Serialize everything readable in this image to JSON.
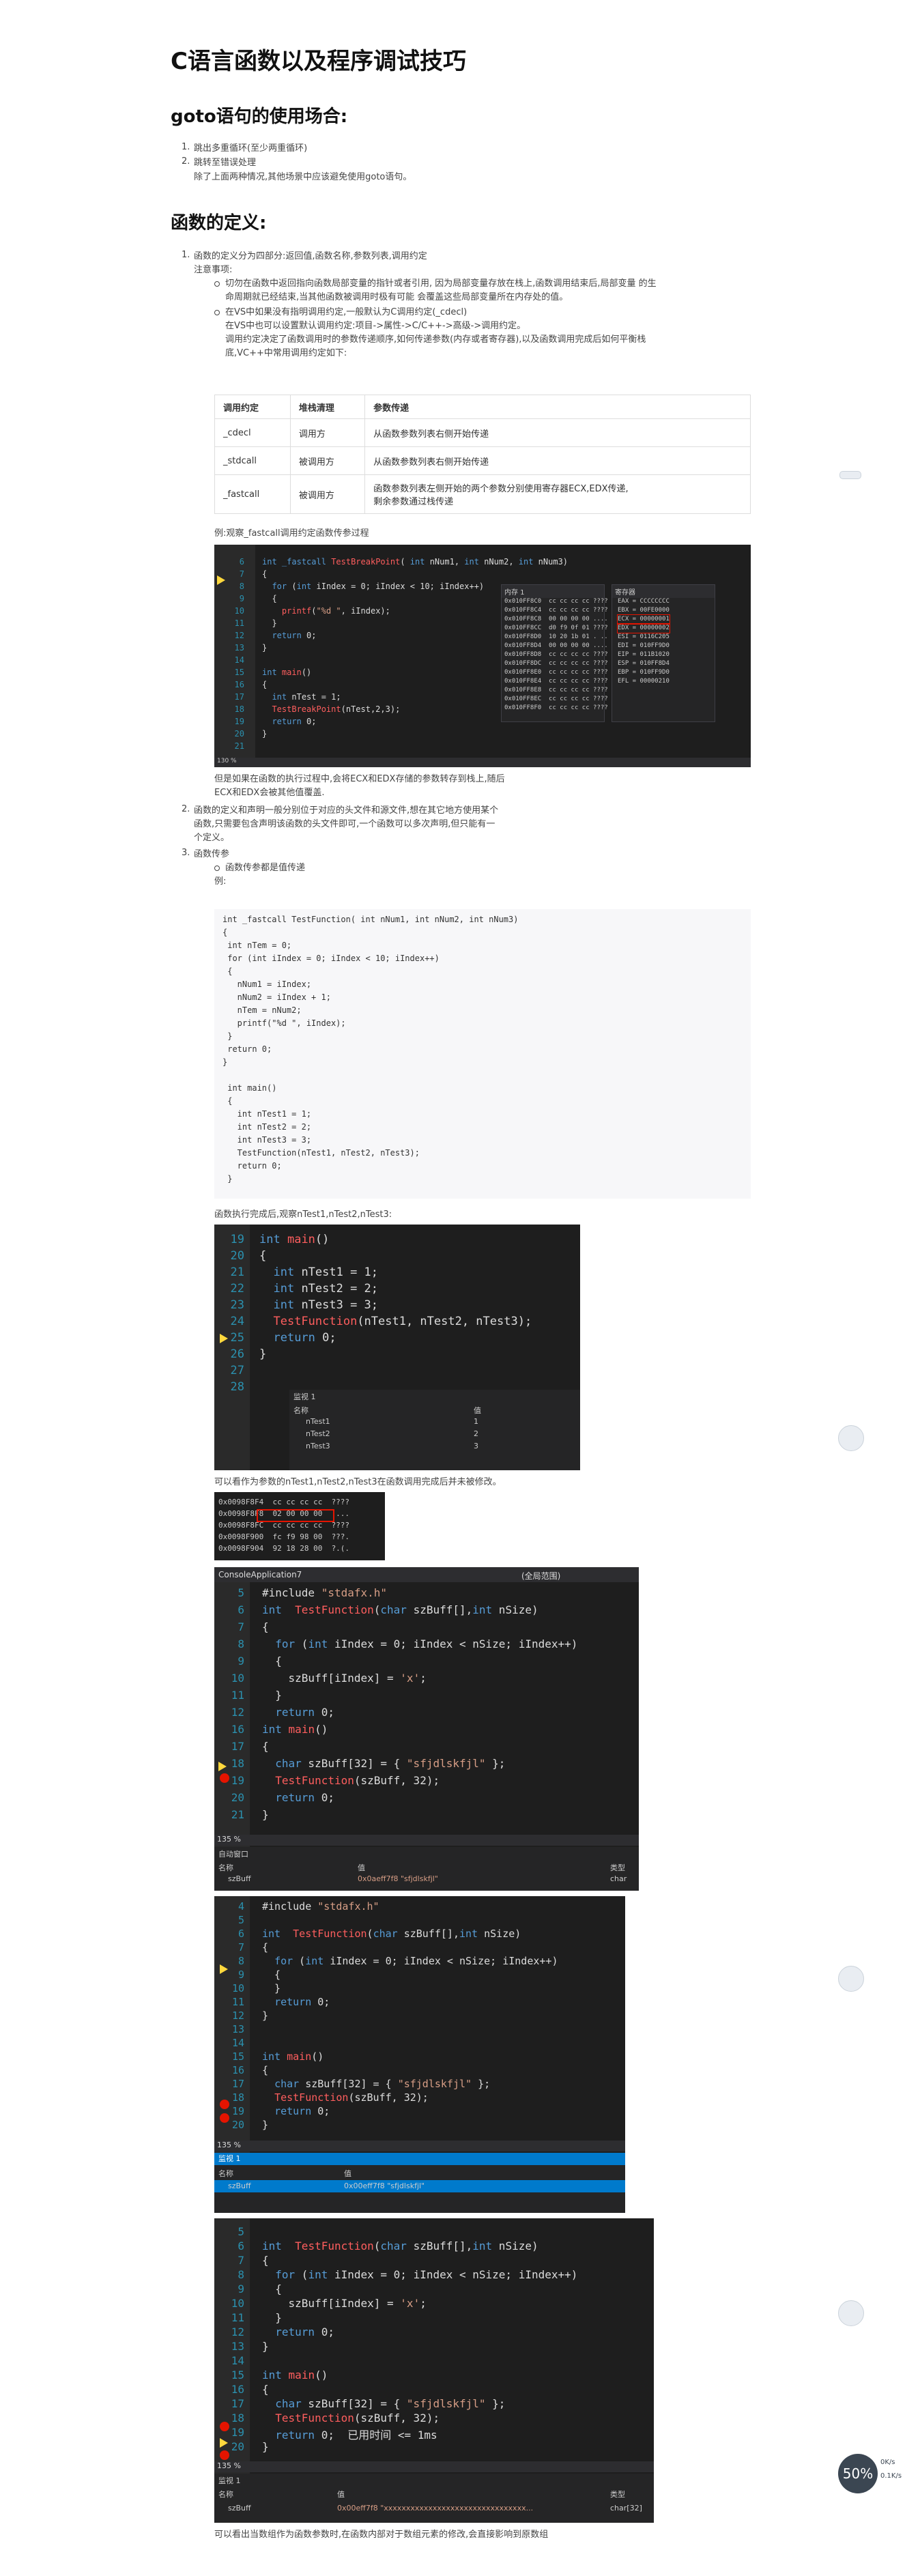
{
  "title": "C语言函数以及程序调试技巧",
  "section_goto": {
    "heading": "goto语句的使用场合:",
    "items": [
      "跳出多重循环(至少两重循环)",
      "跳转至错误处理"
    ],
    "note": "除了上面两种情况,其他场景中应该避免使用goto语句。"
  },
  "section_def": {
    "heading": "函数的定义:",
    "item1": "函数的定义分为四部分:返回值,函数名称,参数列表,调用约定",
    "note_title": "注意事项:",
    "bullet1_l1": "切勿在函数中返回指向函数局部变量的指针或者引用, 因为局部变量存放在栈上,函数调用结束后,局部变量 的生",
    "bullet1_l2": "命周期就已经结束,当其他函数被调用时极有可能 会覆盖这些局部变量所在内存处的值。",
    "bullet2_l1": "在VS中如果没有指明调用约定,一般默认为C调用约定(_cdecl)",
    "bullet2_l2": "在VS中也可以设置默认调用约定:项目->属性->C/C++->高级->调用约定。",
    "bullet2_l3": "调用约定决定了函数调用时的参数传递顺序,如何传递参数(内存或者寄存器),以及函数调用完成后如何平衡栈",
    "bullet2_l4": "底,VC++中常用调用约定如下:",
    "table_headers": [
      "调用约定",
      "堆栈清理",
      "参数传递"
    ],
    "table_rows": [
      [
        "_cdecl",
        "调用方",
        "从函数参数列表右侧开始传递"
      ],
      [
        "_stdcall",
        "被调用方",
        "从函数参数列表右侧开始传递"
      ],
      [
        "_fastcall",
        "被调用方",
        "函数参数列表左侧开始的两个参数分别使用寄存器ECX,EDX传递,",
        "剩余参数通过栈传递"
      ]
    ],
    "example_caption": "例:观察_fastcall调用约定函数传参过程",
    "after_shot1_l1": "但是如果在函数的执行过程中,会将ECX和EDX存储的参数转存到栈上,随后",
    "after_shot1_l2": "ECX和EDX会被其他值覆盖.",
    "item2_l1": "函数的定义和声明一般分别位于对应的头文件和源文件,想在其它地方使用某个",
    "item2_l2": "函数,只需要包含声明该函数的头文件即可,一个函数可以多次声明,但只能有一",
    "item2_l3": "个定义。",
    "item3": "函数传参",
    "bullet3": "函数传参都是值传递",
    "example_label": "例:",
    "after_code_caption": "函数执行完成后,观察nTest1,nTest2,nTest3:",
    "after_shot2": "可以看作为参数的nTest1,nTest2,nTest3在函数调用完成后并未被修改。",
    "bottom_caption": "可以看出当数组作为函数参数时,在函数内部对于数组元素的修改,会直接影响到原数组"
  },
  "code_block": [
    "int _fastcall TestFunction( int nNum1, int nNum2, int nNum3)",
    "{",
    " int nTem = 0;",
    " for (int iIndex = 0; iIndex < 10; iIndex++)",
    " {",
    "   nNum1 = iIndex;",
    "   nNum2 = iIndex + 1;",
    "   nTem = nNum2;",
    "   printf(\"%d \", iIndex);",
    " }",
    " return 0;",
    "}",
    "",
    " int main()",
    " {",
    "   int nTest1 = 1;",
    "   int nTest2 = 2;",
    "   int nTest3 = 3;",
    "   TestFunction(nTest1, nTest2, nTest3);",
    "   return 0;",
    " }"
  ],
  "shot1": {
    "lines": [
      "6",
      "7",
      "8",
      "9",
      "10",
      "11",
      "12",
      "13",
      "14",
      "15",
      "16",
      "17",
      "18",
      "19",
      "20",
      "21"
    ],
    "code": [
      "int _fastcall TestBreakPoint( int nNum1, int nNum2, int nNum3)",
      "{",
      "  for (int iIndex = 0; iIndex < 10; iIndex++)",
      "  {",
      "    printf(\"%d \", iIndex);",
      "  }",
      "  return 0;",
      "}",
      "",
      "int main()",
      "{",
      "  int nTest = 1;",
      "  TestBreakPoint(nTest,2,3);",
      "  return 0;",
      "}",
      ""
    ],
    "mem_title": "内存 1",
    "reg_title": "寄存器",
    "regs": [
      "EAX = CCCCCCCC",
      "EBX = 00FE0000",
      "ECX = 00000001",
      "EDX = 00000002",
      "ESI = 0116C205",
      "EDI = 010FF9D0",
      "EIP = 011B1020",
      "ESP = 010FF8D4",
      "EBP = 010FF9D0",
      "EFL = 00000210"
    ],
    "zoom": "130 %"
  },
  "shot2": {
    "lines": [
      "19",
      "20",
      "21",
      "22",
      "23",
      "24",
      "25",
      "26",
      "27",
      "28"
    ],
    "code": [
      "int main()",
      "{",
      "  int nTest1 = 1;",
      "  int nTest2 = 2;",
      "  int nTest3 = 3;",
      "  TestFunction(nTest1, nTest2, nTest3);",
      "  return 0;",
      "}",
      "",
      ""
    ],
    "watch_title": "监视 1",
    "col_name": "名称",
    "col_value": "值",
    "watch_rows": [
      [
        "nTest1",
        "1"
      ],
      [
        "nTest2",
        "2"
      ],
      [
        "nTest3",
        "3"
      ]
    ]
  },
  "shot3": {
    "hex_lines": [
      "0x0098F8F4  cc cc cc cc  ????",
      "0x0098F8F8  02 00 00 00  ....",
      "0x0098F8FC  cc cc cc cc  ????",
      "0x0098F900  fc f9 98 00  ???.",
      "0x0098F904  92 18 28 00  ?.(."
    ]
  },
  "shot4": {
    "window_title": "ConsoleApplication7",
    "scope": "(全局范围)",
    "lines": [
      "5",
      "6",
      "7",
      "8",
      "9",
      "10",
      "11",
      "12",
      "16",
      "17",
      "18",
      "19",
      "20",
      "21"
    ],
    "code": [
      "#include \"stdafx.h\"",
      "int  TestFunction(char szBuff[],int nSize)",
      "{",
      "  for (int iIndex = 0; iIndex < nSize; iIndex++)",
      "  {",
      "    szBuff[iIndex] = 'x';",
      "  }",
      "  return 0;",
      "int main()",
      "{",
      "  char szBuff[32] = { \"sfjdlskfjl\" };",
      "  TestFunction(szBuff, 32);",
      "  return 0;",
      "}"
    ],
    "zoom": "135 %",
    "panel_title": "自动窗口",
    "col_name": "名称",
    "col_value": "值",
    "col_type": "类型",
    "row_name": "szBuff",
    "row_value": "0x0aeff7f8 \"sfjdlskfjl\"",
    "row_type": "char"
  },
  "shot5": {
    "lines": [
      "4",
      "5",
      "6",
      "7",
      "8",
      "9",
      "10",
      "11",
      "12",
      "13",
      "14",
      "15",
      "16",
      "17",
      "18",
      "19",
      "20"
    ],
    "code": [
      "#include \"stdafx.h\"",
      "",
      "int  TestFunction(char szBuff[],int nSize)",
      "{",
      "  for (int iIndex = 0; iIndex < nSize; iIndex++)",
      "  {",
      "  }",
      "  return 0;",
      "}",
      "",
      "",
      "int main()",
      "{",
      "  char szBuff[32] = { \"sfjdlskfjl\" };",
      "  TestFunction(szBuff, 32);",
      "  return 0;",
      "}"
    ],
    "zoom": "135 %",
    "watch_title": "监视 1",
    "col_name": "名称",
    "col_value": "值",
    "row_name": "szBuff",
    "row_value": "0x00eff7f8 \"sfjdlskfjl\""
  },
  "shot6": {
    "lines": [
      "5",
      "6",
      "7",
      "8",
      "9",
      "10",
      "11",
      "12",
      "13",
      "14",
      "15",
      "16",
      "17",
      "18",
      "19",
      "20"
    ],
    "code": [
      "",
      "int  TestFunction(char szBuff[],int nSize)",
      "{",
      "  for (int iIndex = 0; iIndex < nSize; iIndex++)",
      "  {",
      "    szBuff[iIndex] = 'x';",
      "  }",
      "  return 0;",
      "}",
      "",
      "int main()",
      "{",
      "  char szBuff[32] = { \"sfjdlskfjl\" };",
      "  TestFunction(szBuff, 32);",
      "  return 0;  已用时间 <= 1ms",
      "}"
    ],
    "zoom": "135 %",
    "watch_title": "监视 1",
    "col_name": "名称",
    "col_value": "值",
    "col_type": "类型",
    "row_name": "szBuff",
    "row_value": "0x00eff7f8 \"xxxxxxxxxxxxxxxxxxxxxxxxxxxxxxxx...",
    "row_type": "char[32]"
  },
  "zoom_badge": "50%",
  "net_speed": [
    "0K/s",
    "0.1K/s"
  ]
}
